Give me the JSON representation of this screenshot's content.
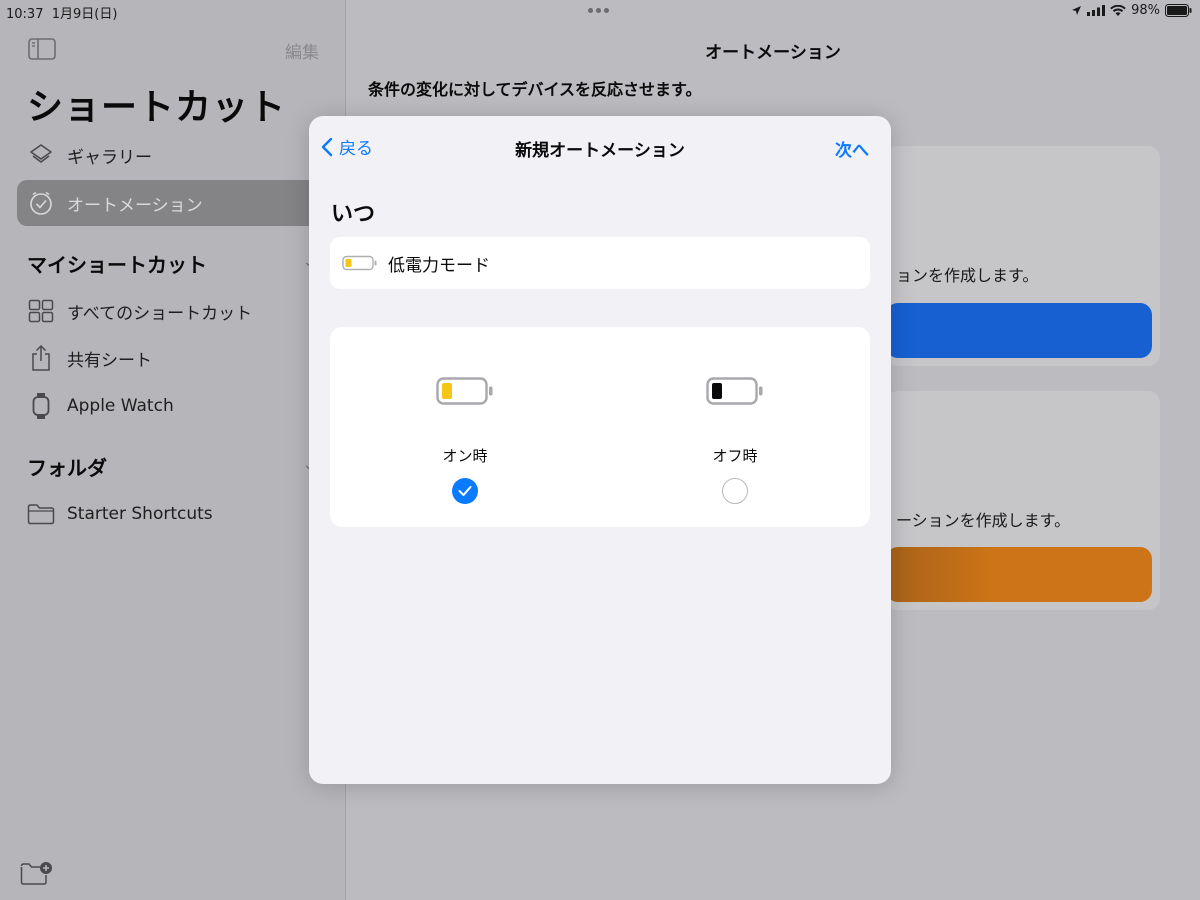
{
  "status_bar": {
    "time": "10:37",
    "date": "1月9日(日)",
    "battery_percent": "98%"
  },
  "sidebar": {
    "edit_label": "編集",
    "title": "ショートカット",
    "items": [
      {
        "label": "ギャラリー",
        "icon": "layers-icon"
      },
      {
        "label": "オートメーション",
        "icon": "clock-check-icon",
        "selected": true
      }
    ],
    "my_shortcuts_header": "マイショートカット",
    "my_shortcuts": [
      {
        "label": "すべてのショートカット",
        "icon": "grid-icon"
      },
      {
        "label": "共有シート",
        "icon": "share-icon"
      },
      {
        "label": "Apple Watch",
        "icon": "watch-icon"
      }
    ],
    "folders_header": "フォルダ",
    "folders": [
      {
        "label": "Starter Shortcuts",
        "icon": "folder-icon"
      }
    ]
  },
  "detail": {
    "title": "オートメーション",
    "description": "条件の変化に対してデバイスを反応させます。",
    "card1_text": "ョンを作成します。",
    "card2_text": "ーションを作成します。",
    "colors": {
      "card1_button": "#1660d2",
      "card2_button": "#cc7417"
    }
  },
  "modal": {
    "back_label": "戻る",
    "title": "新規オートメーション",
    "next_label": "次へ",
    "when_heading": "いつ",
    "trigger_label": "低電力モード",
    "options": [
      {
        "label": "オン時",
        "checked": true,
        "battery_fill_color": "#f5c518"
      },
      {
        "label": "オフ時",
        "checked": false,
        "battery_fill_color": "#0a0a0a"
      }
    ],
    "accent_color": "#0a7aff"
  }
}
